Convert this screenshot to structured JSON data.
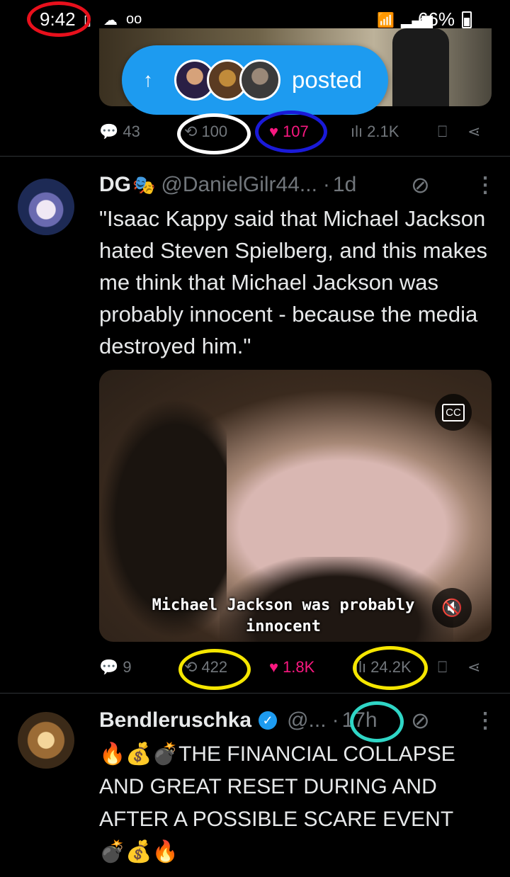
{
  "status_bar": {
    "time": "9:42",
    "battery": "66%"
  },
  "posted_banner": {
    "label": "posted"
  },
  "prev_post": {
    "replies": "43",
    "reposts": "100",
    "likes": "107",
    "views": "2.1K"
  },
  "tweet1": {
    "name": "DG",
    "name_emoji": "🎭",
    "handle": "@DanielGilr44...",
    "dot": "·",
    "time": "1d",
    "text": "\"Isaac Kappy said that Michael Jackson hated Steven Spielberg, and this makes me think that Michael Jackson was probably innocent - because the media destroyed him.\"",
    "video_caption": "Michael Jackson was probably innocent",
    "cc_label": "CC",
    "replies": "9",
    "reposts": "422",
    "likes": "1.8K",
    "views": "24.2K"
  },
  "tweet2": {
    "name": "Bendleruschka",
    "handle": "@...",
    "dot": "·",
    "time": "17h",
    "text_prefix": "🔥💰💣",
    "text": "THE FINANCIAL COLLAPSE AND GREAT RESET DURING AND AFTER A POSSIBLE SCARE EVENT",
    "text_suffix": "💣💰🔥"
  },
  "colors": {
    "accent": "#1d9bf0",
    "like": "#f91880",
    "muted": "#71767b",
    "annotation_red": "#e8101c",
    "annotation_white": "#ffffff",
    "annotation_blue": "#1a1ad8",
    "annotation_yellow": "#f5e600",
    "annotation_cyan": "#2fd6c6"
  },
  "icons": [
    "reply-icon",
    "repost-icon",
    "heart-icon",
    "views-icon",
    "bookmark-icon",
    "share-icon",
    "grok-icon",
    "more-icon",
    "verified-icon",
    "cc-icon",
    "mute-icon",
    "wifi-icon",
    "signal-icon",
    "cloud-icon",
    "voicemail-icon"
  ]
}
